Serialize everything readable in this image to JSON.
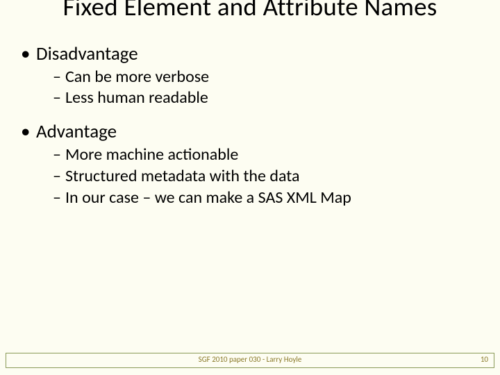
{
  "title": "Fixed Element and Attribute Names",
  "sections": [
    {
      "heading": "Disadvantage",
      "items": [
        "Can be more verbose",
        "Less human readable"
      ]
    },
    {
      "heading": "Advantage",
      "items": [
        "More machine actionable",
        "Structured metadata with the data",
        "In our case – we can make a SAS XML Map"
      ]
    }
  ],
  "footer": {
    "center": "SGF 2010 paper 030 - Larry Hoyle",
    "page": "10"
  }
}
